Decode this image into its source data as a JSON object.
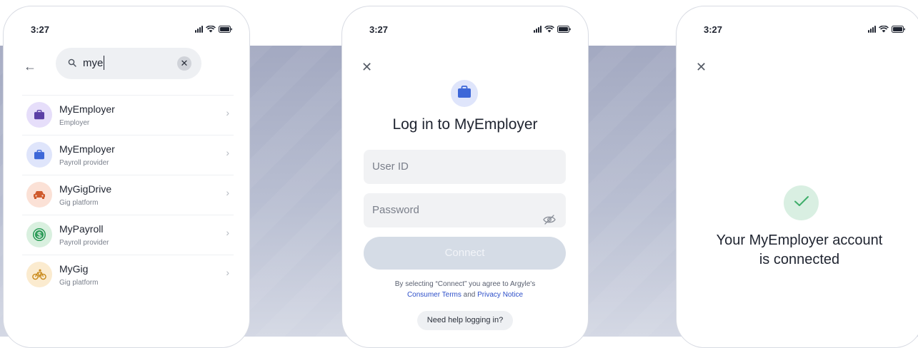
{
  "status_bar": {
    "time": "3:27"
  },
  "screen1": {
    "search": {
      "query": "mye"
    },
    "results": [
      {
        "name": "MyEmployer",
        "type": "Employer",
        "icon": "briefcase-icon",
        "bg": "#e6defa",
        "fg": "#5b3fa6"
      },
      {
        "name": "MyEmployer",
        "type": "Payroll provider",
        "icon": "briefcase-icon",
        "bg": "#dfe5fb",
        "fg": "#3d67d8"
      },
      {
        "name": "MyGigDrive",
        "type": "Gig platform",
        "icon": "car-icon",
        "bg": "#fbe1d6",
        "fg": "#cf5a2c"
      },
      {
        "name": "MyPayroll",
        "type": "Payroll provider",
        "icon": "dollar-icon",
        "bg": "#d9f0df",
        "fg": "#2f9e5a"
      },
      {
        "name": "MyGig",
        "type": "Gig platform",
        "icon": "bicycle-icon",
        "bg": "#fbebcf",
        "fg": "#c98a1b"
      }
    ]
  },
  "screen2": {
    "title": "Log in to MyEmployer",
    "user_id_placeholder": "User ID",
    "password_placeholder": "Password",
    "connect_label": "Connect",
    "terms_prefix": "By selecting “Connect” you agree to Argyle's",
    "terms_link": "Consumer Terms",
    "terms_and": " and ",
    "privacy_link": "Privacy Notice",
    "help_label": "Need help logging in?"
  },
  "screen3": {
    "message_line1": "Your MyEmployer account",
    "message_line2": "is connected"
  },
  "colors": {
    "background_band": "#a3a9c1",
    "accent_blue": "#3d67d8",
    "link": "#2d4fc9",
    "connect_disabled": "#d5dce6",
    "success_bg": "#d9efe2",
    "success_check": "#3fae6a"
  }
}
